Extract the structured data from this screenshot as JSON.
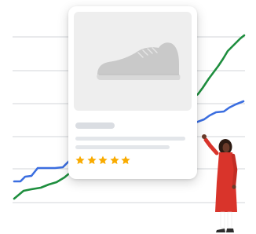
{
  "illustration": {
    "description_free": true,
    "colors": {
      "green_line": "#1e8e3e",
      "blue_line": "#3b6ee0",
      "gridline": "#cfd3d8",
      "card_bg": "#ffffff",
      "image_bg": "#eeeeee",
      "placeholder": "#dadde2",
      "star": "#f9ab00",
      "dress": "#d9342b",
      "skin": "#6b3b2a",
      "hijab": "#2d1a12"
    },
    "product_card": {
      "image_icon": "sneaker-icon",
      "rating_stars": 5,
      "rating_max": 5
    }
  }
}
